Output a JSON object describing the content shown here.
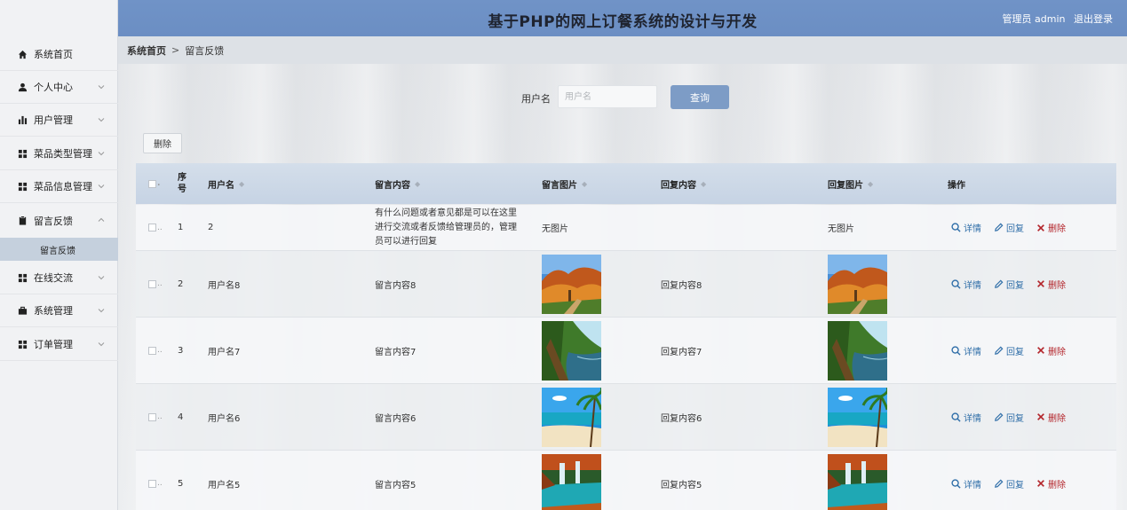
{
  "header": {
    "title": "基于PHP的网上订餐系统的设计与开发",
    "user_label": "管理员 admin",
    "logout": "退出登录"
  },
  "breadcrumb": {
    "home": "系统首页",
    "separator": ">",
    "current": "留言反馈"
  },
  "sidebar": {
    "items": [
      {
        "label": "系统首页",
        "icon": "home-icon"
      },
      {
        "label": "个人中心",
        "icon": "user-icon"
      },
      {
        "label": "用户管理",
        "icon": "bar-chart-icon"
      },
      {
        "label": "菜品类型管理",
        "icon": "grid-icon"
      },
      {
        "label": "菜品信息管理",
        "icon": "grid-icon"
      },
      {
        "label": "留言反馈",
        "icon": "clipboard-icon"
      },
      {
        "label": "在线交流",
        "icon": "grid-icon"
      },
      {
        "label": "系统管理",
        "icon": "briefcase-icon"
      },
      {
        "label": "订单管理",
        "icon": "grid-icon"
      }
    ],
    "sub_item": "留言反馈"
  },
  "search": {
    "label": "用户名",
    "placeholder": "用户名",
    "button": "查询"
  },
  "toolbar": {
    "delete": "删除"
  },
  "table": {
    "headers": {
      "index": "序号",
      "username": "用户名",
      "content": "留言内容",
      "image": "留言图片",
      "reply": "回复内容",
      "reply_image": "回复图片",
      "actions": "操作"
    },
    "no_image": "无图片",
    "actions": {
      "detail": "详情",
      "reply": "回复",
      "delete": "删除"
    },
    "rows": [
      {
        "index": "1",
        "username": "2",
        "content": "有什么问题或者意见都是可以在这里进行交流或者反馈给管理员的，管理员可以进行回复",
        "image": "none",
        "reply": "",
        "reply_image": "none"
      },
      {
        "index": "2",
        "username": "用户名8",
        "content": "留言内容8",
        "image": "autumn-trees",
        "reply": "回复内容8",
        "reply_image": "autumn-trees"
      },
      {
        "index": "3",
        "username": "用户名7",
        "content": "留言内容7",
        "image": "forest-river",
        "reply": "回复内容7",
        "reply_image": "forest-river"
      },
      {
        "index": "4",
        "username": "用户名6",
        "content": "留言内容6",
        "image": "tropical-beach",
        "reply": "回复内容6",
        "reply_image": "tropical-beach"
      },
      {
        "index": "5",
        "username": "用户名5",
        "content": "留言内容5",
        "image": "waterfall-lagoon",
        "reply": "回复内容5",
        "reply_image": "waterfall-lagoon"
      }
    ]
  },
  "colors": {
    "header": "#6b8ec3",
    "accent_button": "#7d9cc6",
    "delete_red": "#b3242a",
    "link_blue": "#2f6ea8"
  }
}
